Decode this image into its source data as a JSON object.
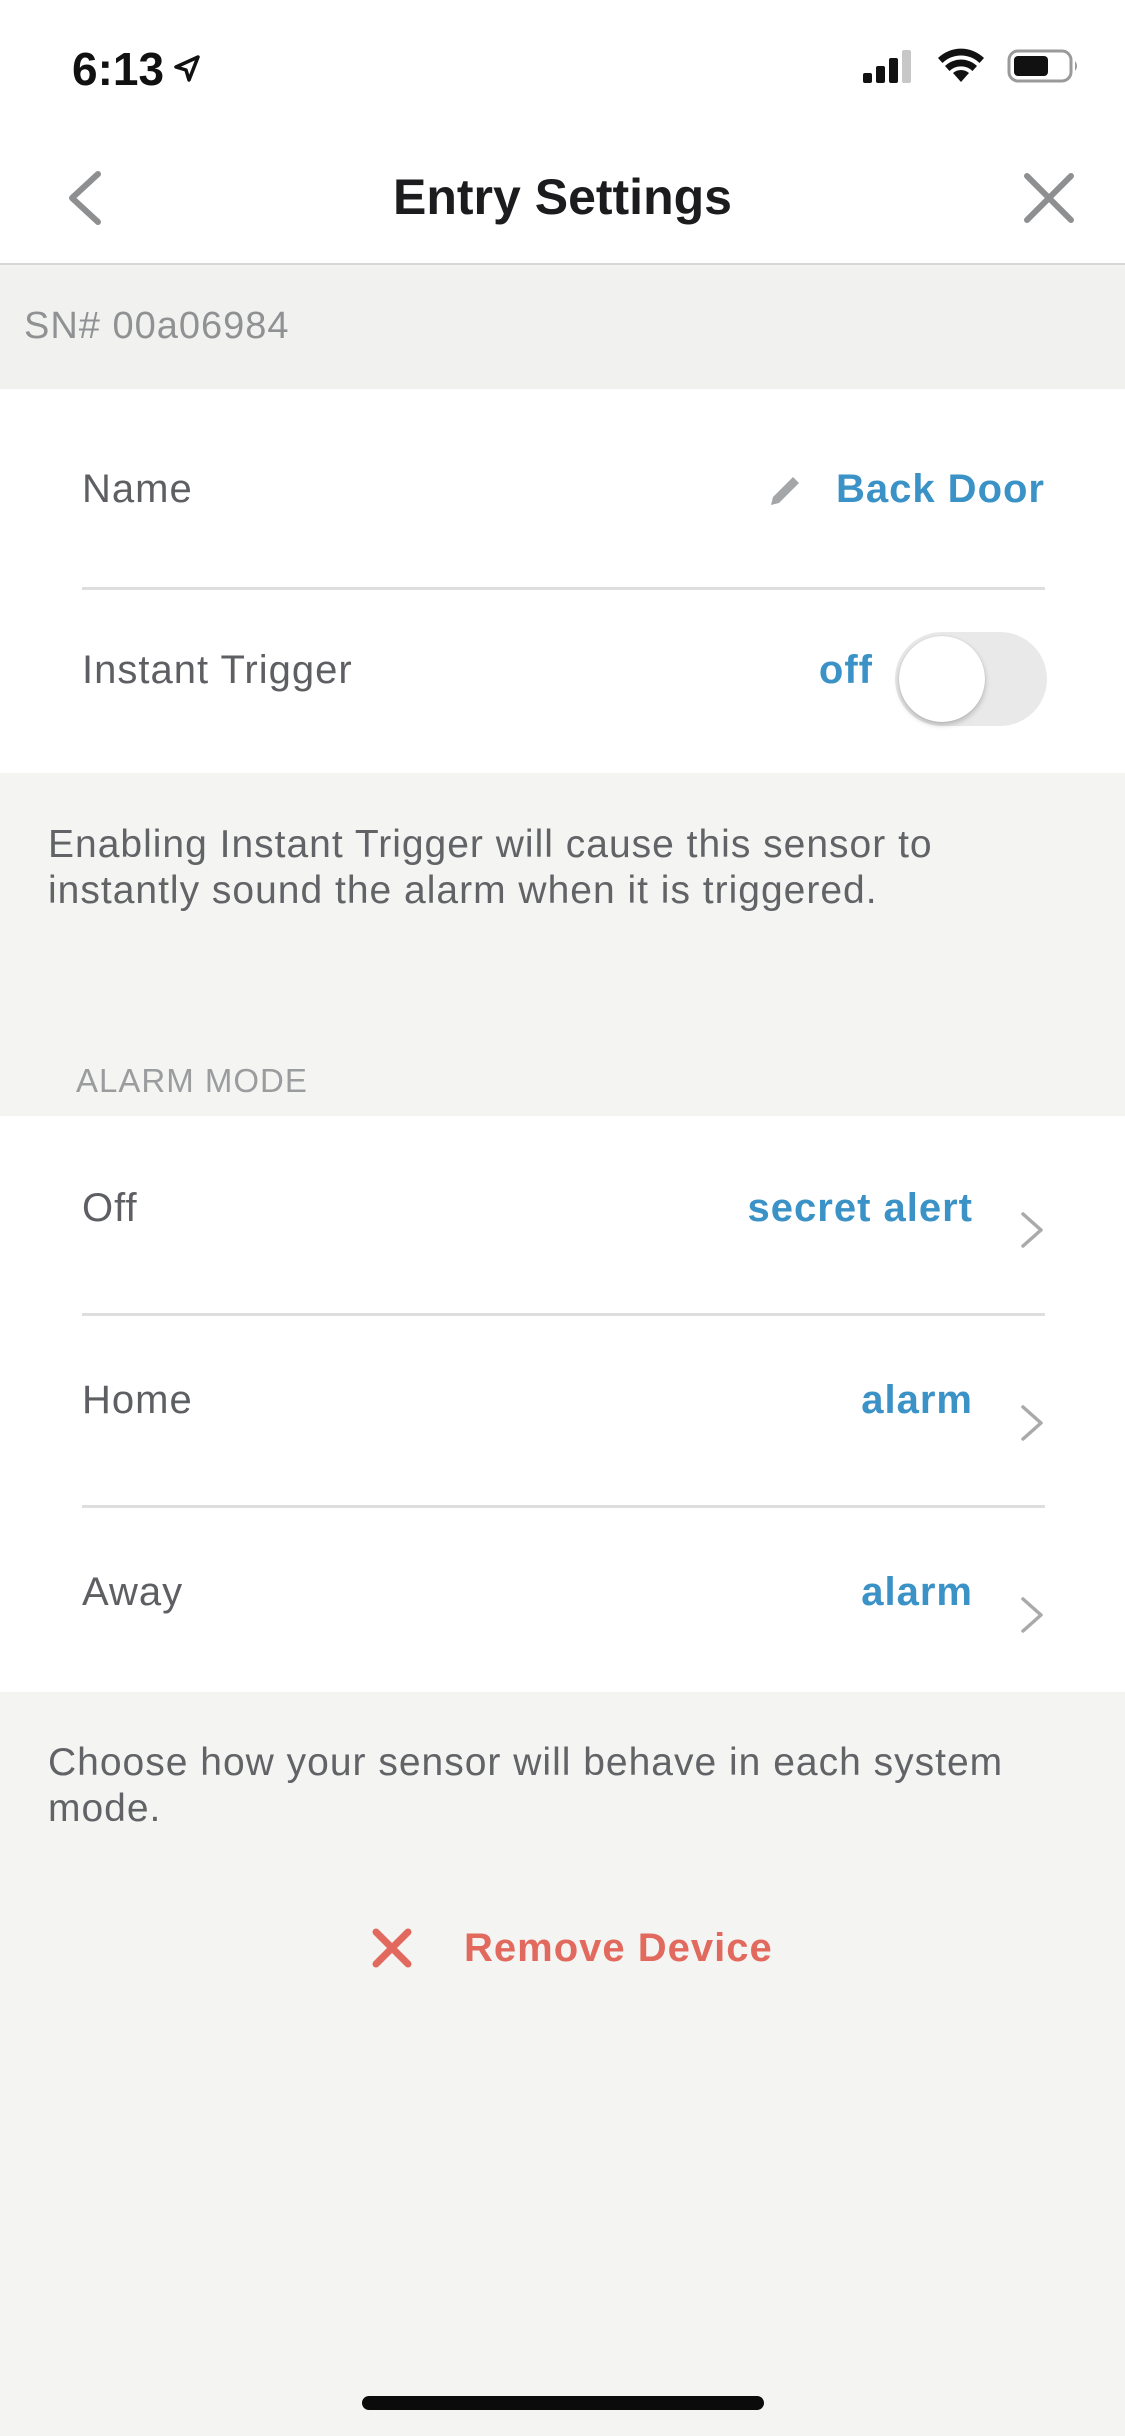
{
  "status_bar": {
    "time": "6:13"
  },
  "nav": {
    "title": "Entry Settings"
  },
  "serial": "SN# 00a06984",
  "settings": {
    "name_label": "Name",
    "name_value": "Back Door",
    "instant_trigger_label": "Instant Trigger",
    "instant_trigger_state": "off"
  },
  "instant_trigger_note": "Enabling Instant Trigger will cause this sensor to instantly sound the alarm when it is triggered.",
  "alarm_mode": {
    "header": "ALARM MODE",
    "rows": [
      {
        "label": "Off",
        "value": "secret alert"
      },
      {
        "label": "Home",
        "value": "alarm"
      },
      {
        "label": "Away",
        "value": "alarm"
      }
    ]
  },
  "alarm_mode_note": "Choose how your sensor will behave in each system mode.",
  "remove_device_label": "Remove Device",
  "colors": {
    "accent": "#3a92c6",
    "danger": "#e2695d",
    "background": "#f4f4f3"
  }
}
